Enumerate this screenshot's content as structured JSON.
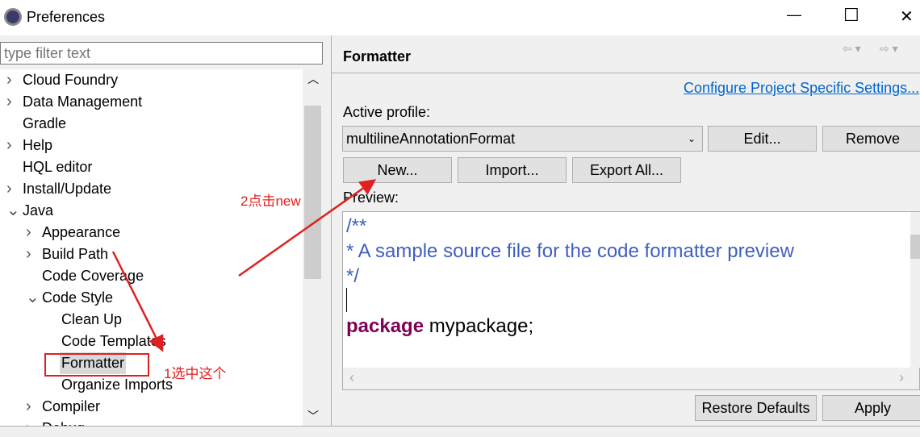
{
  "window": {
    "title": "Preferences",
    "minimize": "—",
    "maximize": "☐",
    "close": "✕"
  },
  "filter": {
    "placeholder": "type filter text"
  },
  "tree": [
    {
      "label": "Cloud Foundry",
      "level": 0,
      "chevron": "›"
    },
    {
      "label": "Data Management",
      "level": 0,
      "chevron": "›"
    },
    {
      "label": "Gradle",
      "level": 0,
      "chevron": ""
    },
    {
      "label": "Help",
      "level": 0,
      "chevron": "›"
    },
    {
      "label": "HQL editor",
      "level": 0,
      "chevron": ""
    },
    {
      "label": "Install/Update",
      "level": 0,
      "chevron": "›"
    },
    {
      "label": "Java",
      "level": 0,
      "chevron": "⌄"
    },
    {
      "label": "Appearance",
      "level": 1,
      "chevron": "›"
    },
    {
      "label": "Build Path",
      "level": 1,
      "chevron": "›"
    },
    {
      "label": "Code Coverage",
      "level": 1,
      "chevron": ""
    },
    {
      "label": "Code Style",
      "level": 1,
      "chevron": "⌄"
    },
    {
      "label": "Clean Up",
      "level": 2,
      "chevron": ""
    },
    {
      "label": "Code Templates",
      "level": 2,
      "chevron": ""
    },
    {
      "label": "Formatter",
      "level": 2,
      "chevron": "",
      "selected": true
    },
    {
      "label": "Organize Imports",
      "level": 2,
      "chevron": ""
    },
    {
      "label": "Compiler",
      "level": 1,
      "chevron": "›"
    },
    {
      "label": "Debug",
      "level": 1,
      "chevron": "›"
    }
  ],
  "page": {
    "title": "Formatter",
    "link": "Configure Project Specific Settings...",
    "active_profile_label": "Active profile:",
    "profile": "multilineAnnotationFormat",
    "edit": "Edit...",
    "remove": "Remove",
    "new": "New...",
    "import": "Import...",
    "export": "Export All...",
    "preview_label": "Preview:"
  },
  "code": {
    "line1": "/**",
    "line2": "* A sample source file for the code formatter preview",
    "line3": "*/",
    "keyword": "package",
    "pkg": " mypackage;"
  },
  "footer": {
    "restore": "Restore Defaults",
    "apply": "Apply"
  },
  "annotations": {
    "step1": "1选中这个",
    "step2": "2点击new"
  }
}
